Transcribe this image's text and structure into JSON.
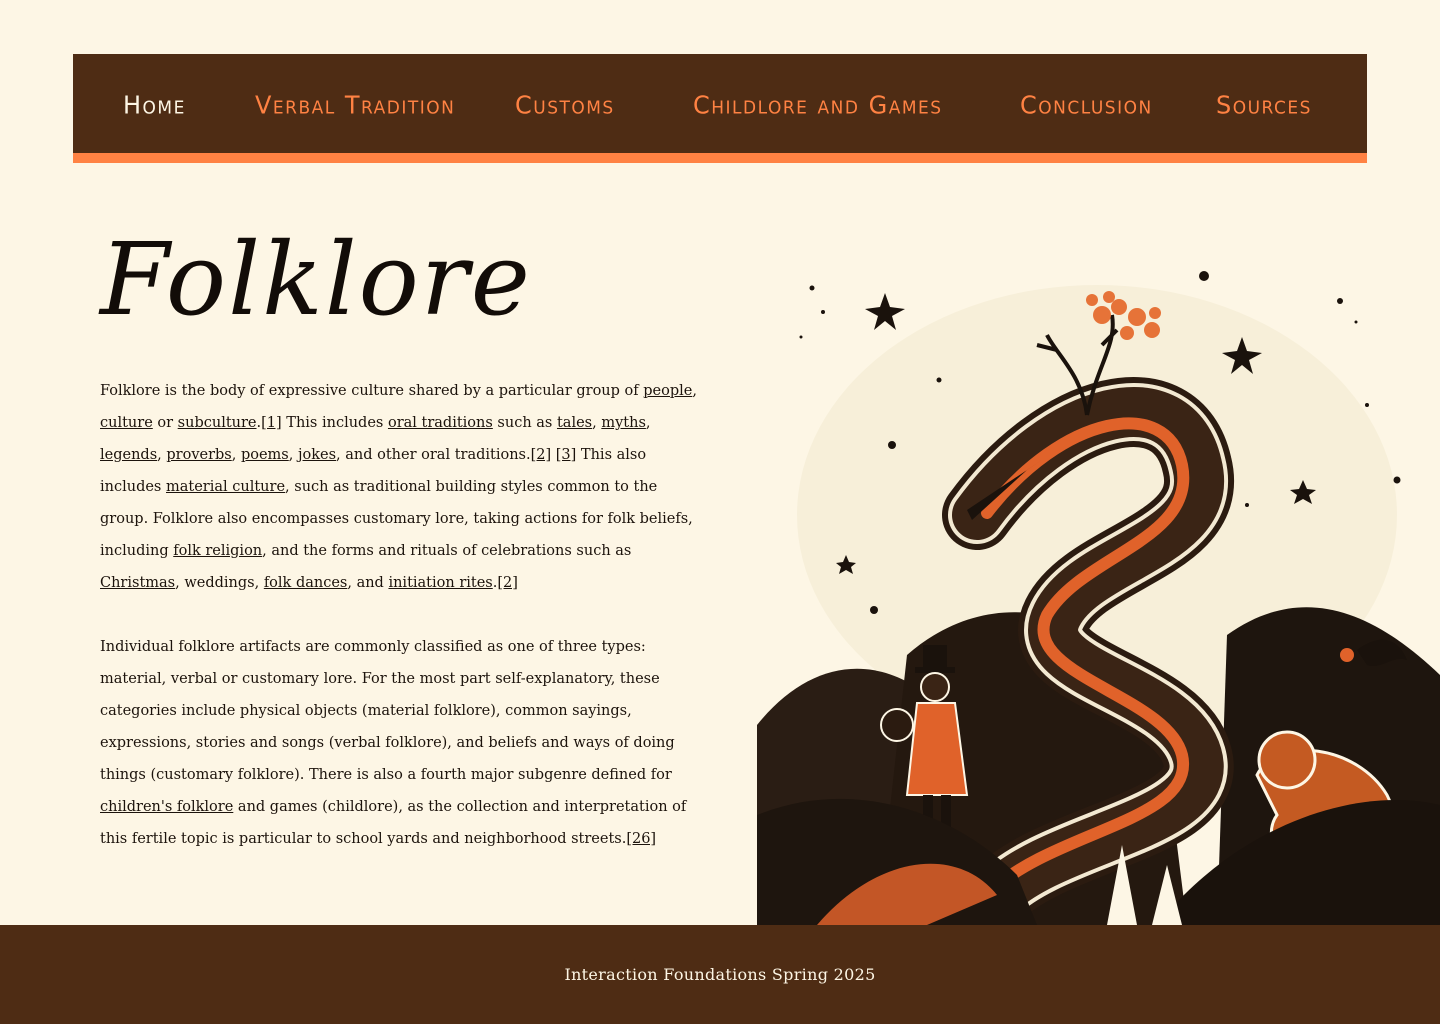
{
  "nav": {
    "items": [
      {
        "label": "Home",
        "active": true
      },
      {
        "label": "Verbal Tradition",
        "active": false
      },
      {
        "label": "Customs",
        "active": false
      },
      {
        "label": "Childlore and Games",
        "active": false
      },
      {
        "label": "Conclusion",
        "active": false
      },
      {
        "label": "Sources",
        "active": false
      }
    ]
  },
  "page": {
    "title": "Folklore"
  },
  "article": {
    "p1": [
      {
        "t": "Folklore is the body of expressive culture shared by a particular group of "
      },
      {
        "t": "people",
        "link": true
      },
      {
        "t": ", "
      },
      {
        "t": "culture",
        "link": true
      },
      {
        "t": " or "
      },
      {
        "t": "subculture",
        "link": true
      },
      {
        "t": "."
      },
      {
        "t": "[1]",
        "link": true
      },
      {
        "t": " This includes "
      },
      {
        "t": "oral traditions",
        "link": true
      },
      {
        "t": " such as "
      },
      {
        "t": "tales",
        "link": true
      },
      {
        "t": ", "
      },
      {
        "t": "myths",
        "link": true
      },
      {
        "t": ", "
      },
      {
        "t": "legends",
        "link": true
      },
      {
        "t": ", "
      },
      {
        "t": "proverbs",
        "link": true
      },
      {
        "t": ", "
      },
      {
        "t": "poems",
        "link": true
      },
      {
        "t": ", "
      },
      {
        "t": "jokes",
        "link": true
      },
      {
        "t": ", and other oral traditions."
      },
      {
        "t": "[2]",
        "link": true
      },
      {
        "t": " "
      },
      {
        "t": "[3]",
        "link": true
      },
      {
        "t": " This also includes "
      },
      {
        "t": "material culture",
        "link": true
      },
      {
        "t": ", such as traditional building styles common to the group. Folklore also encompasses customary lore, taking actions for folk beliefs, including "
      },
      {
        "t": "folk religion",
        "link": true
      },
      {
        "t": ", and the forms and rituals of celebrations such as "
      },
      {
        "t": "Christmas",
        "link": true
      },
      {
        "t": ", weddings, "
      },
      {
        "t": "folk dances",
        "link": true
      },
      {
        "t": ", and "
      },
      {
        "t": "initiation rites",
        "link": true
      },
      {
        "t": "."
      },
      {
        "t": "[2]",
        "link": true
      }
    ],
    "p2": [
      {
        "t": "Individual folklore artifacts are commonly classified as one of three types: material, verbal or customary lore. For the most part self-explanatory, these categories include physical objects (material folklore), common sayings, expressions, stories and songs (verbal folklore), and beliefs and ways of doing things (customary folklore). There is also a fourth major subgenre defined for "
      },
      {
        "t": "children's folklore",
        "link": true
      },
      {
        "t": " and games (childlore), as the collection and interpretation of this fertile topic is particular to school yards and neighborhood streets."
      },
      {
        "t": "[26]",
        "link": true
      }
    ]
  },
  "footer": {
    "text": "Interaction Foundations Spring 2025"
  },
  "colors": {
    "background": "#fdf6e5",
    "brown": "#4e2c14",
    "accent": "#ff8243",
    "text": "#1c130c"
  },
  "illustration": {
    "icons": [
      "dragon-icon",
      "tree-icon",
      "star-icon",
      "boy-with-top-hat-icon",
      "bear-icon",
      "rabbit-icon",
      "bird-icon",
      "hill-icon"
    ]
  }
}
